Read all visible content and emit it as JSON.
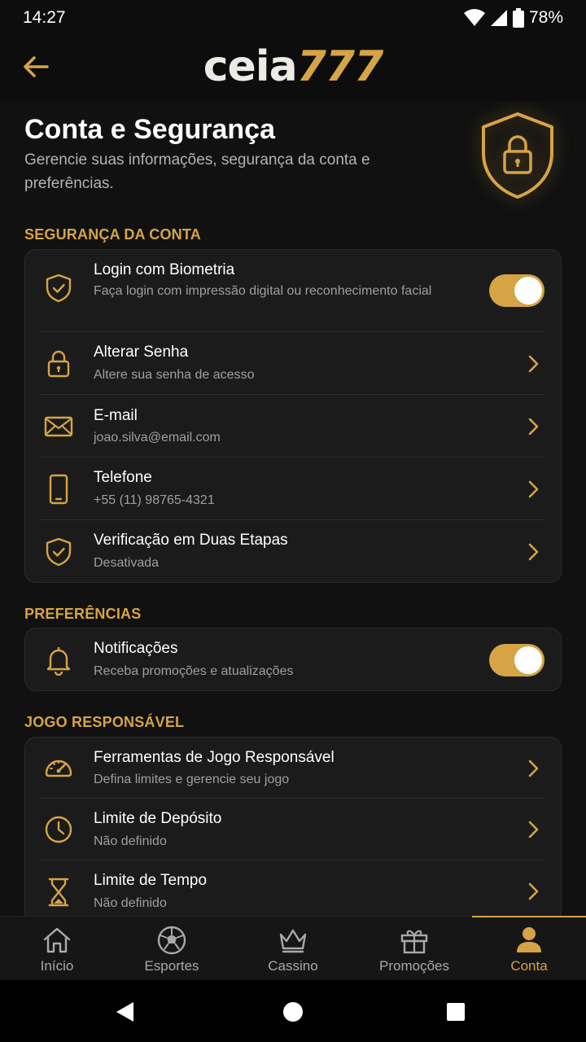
{
  "status_bar": {
    "time": "14:27",
    "battery": "78%"
  },
  "header": {
    "logo_text": "ceia",
    "logo_number": "777",
    "back_icon": "arrow-left-icon"
  },
  "page": {
    "title": "Conta e Segurança",
    "subtitle": "Gerencie suas informações, segurança da conta e preferências."
  },
  "sections": {
    "security": {
      "title": "SEGURANÇA DA CONTA",
      "items": [
        {
          "title": "Login com Biometria",
          "subtitle": "Faça login com impressão digital ou reconhecimento facial",
          "icon": "shield-check-icon",
          "control": "toggle",
          "enabled": true
        },
        {
          "title": "Alterar Senha",
          "subtitle": "Altere sua senha de acesso",
          "icon": "lock-icon",
          "control": "chevron"
        },
        {
          "title": "E-mail",
          "subtitle": "joao.silva@email.com",
          "icon": "mail-icon",
          "control": "chevron"
        },
        {
          "title": "Telefone",
          "subtitle": "+55 (11) 98765-4321",
          "icon": "phone-icon",
          "control": "chevron"
        },
        {
          "title": "Verificação em Duas Etapas",
          "subtitle": "Desativada",
          "icon": "shield-check-icon",
          "control": "chevron"
        }
      ]
    },
    "preferences": {
      "title": "PREFERÊNCIAS",
      "items": [
        {
          "title": "Notificações",
          "subtitle": "Receba promoções e atualizações",
          "icon": "bell-icon",
          "control": "toggle",
          "enabled": true
        }
      ]
    },
    "responsible": {
      "title": "JOGO RESPONSÁVEL",
      "items": [
        {
          "title": "Ferramentas de Jogo Responsável",
          "subtitle": "Defina limites e gerencie seu jogo",
          "icon": "gauge-icon",
          "control": "chevron"
        },
        {
          "title": "Limite de Depósito",
          "subtitle": "Não definido",
          "icon": "clock-icon",
          "control": "chevron"
        },
        {
          "title": "Limite de Tempo",
          "subtitle": "Não definido",
          "icon": "hourglass-icon",
          "control": "chevron"
        }
      ]
    }
  },
  "bottom_nav": [
    {
      "label": "Início",
      "icon": "home-icon"
    },
    {
      "label": "Esportes",
      "icon": "soccer-ball-icon"
    },
    {
      "label": "Cassino",
      "icon": "crown-icon"
    },
    {
      "label": "Promoções",
      "icon": "gift-icon"
    },
    {
      "label": "Conta",
      "icon": "user-icon",
      "active": true
    }
  ],
  "colors": {
    "accent": "#d6a445",
    "background": "#111111",
    "card": "#1b1b1b",
    "muted_text": "#9f9f9f"
  }
}
